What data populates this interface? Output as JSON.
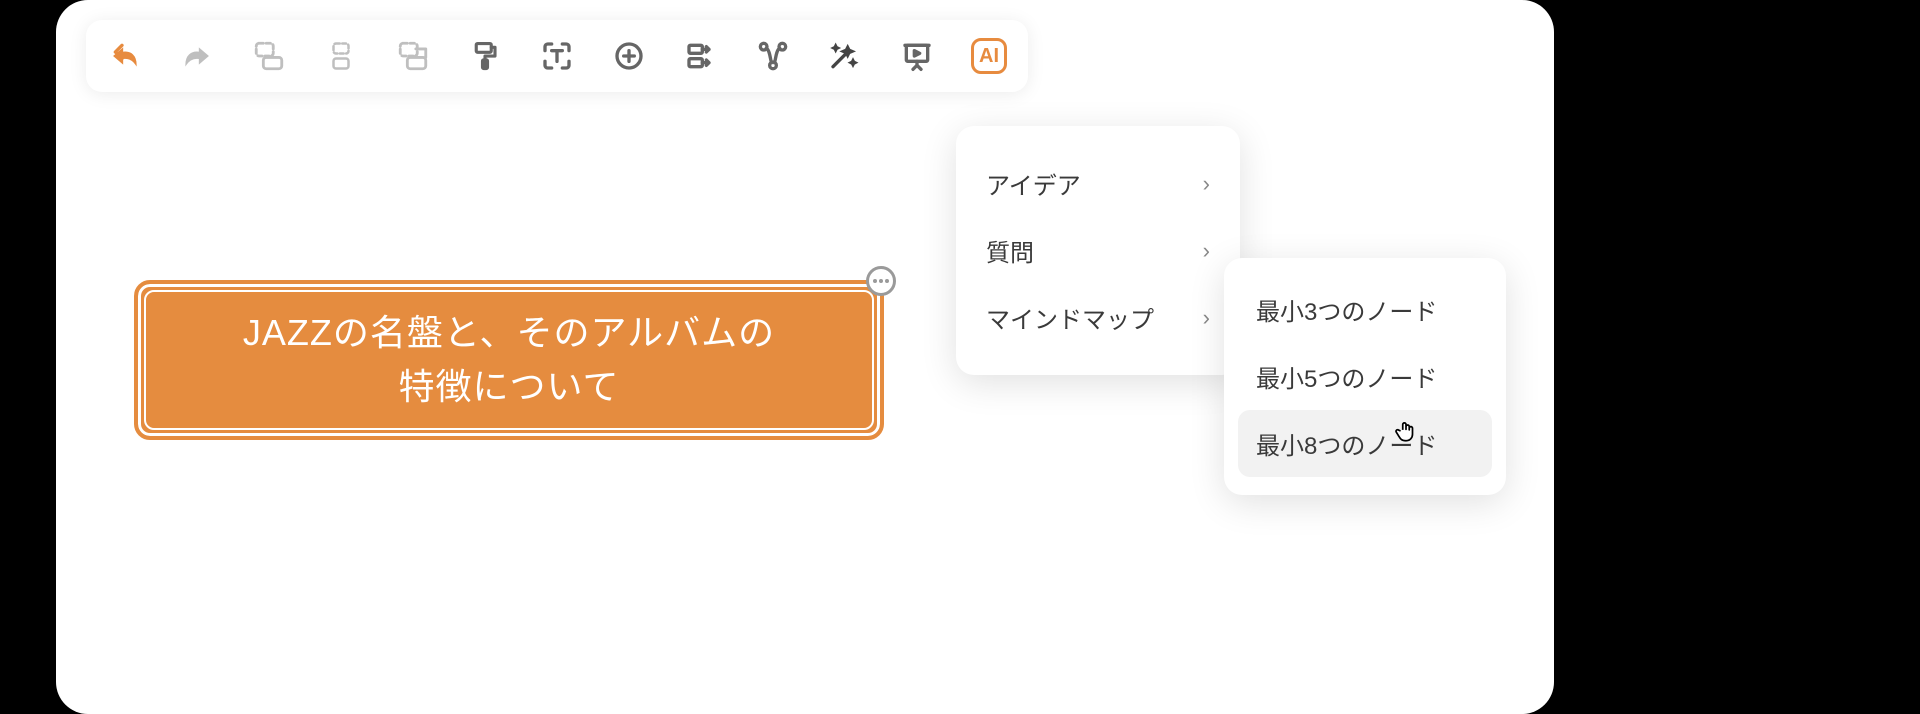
{
  "toolbar": {
    "icons": [
      "undo-icon",
      "redo-icon",
      "select-box-icon",
      "group-icon",
      "group-box-icon",
      "format-paint-icon",
      "text-icon",
      "add-circle-icon",
      "align-icon",
      "connector-icon",
      "magic-wand-icon",
      "presentation-icon",
      "ai-icon"
    ],
    "ai_label": "AI"
  },
  "node": {
    "text": "JAZZの名盤と、そのアルバムの\n特徴について"
  },
  "menu": {
    "items": [
      {
        "label": "アイデア"
      },
      {
        "label": "質問"
      },
      {
        "label": "マインドマップ"
      }
    ]
  },
  "submenu": {
    "items": [
      {
        "label": "最小3つのノード"
      },
      {
        "label": "最小5つのノード"
      },
      {
        "label": "最小8つのノード"
      }
    ],
    "hover_index": 2
  }
}
